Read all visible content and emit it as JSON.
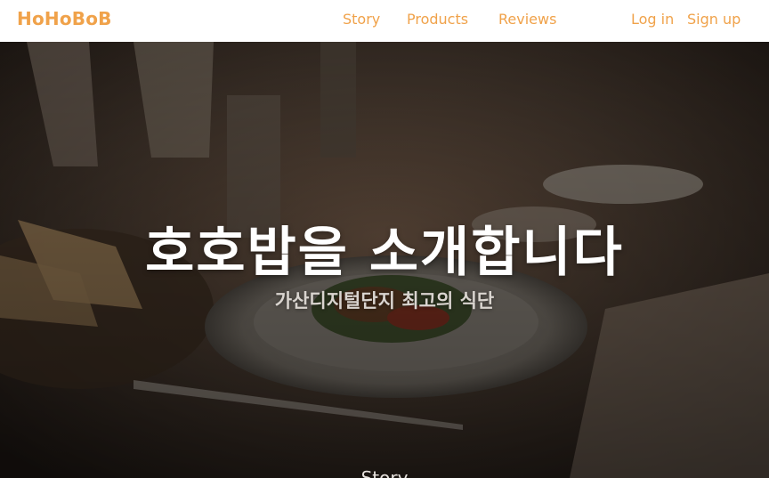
{
  "header": {
    "logo": "HoHoBoB",
    "nav": {
      "story": "Story",
      "products": "Products",
      "reviews": "Reviews",
      "login": "Log in",
      "signup": "Sign up"
    }
  },
  "hero": {
    "title": "호호밥을 소개합니다",
    "subtitle": "가산디지털단지 최고의 식단",
    "section_label": "Story"
  },
  "colors": {
    "accent": "#f0a24a",
    "hero_overlay": "#2a221c",
    "text_light": "#ffffff"
  }
}
